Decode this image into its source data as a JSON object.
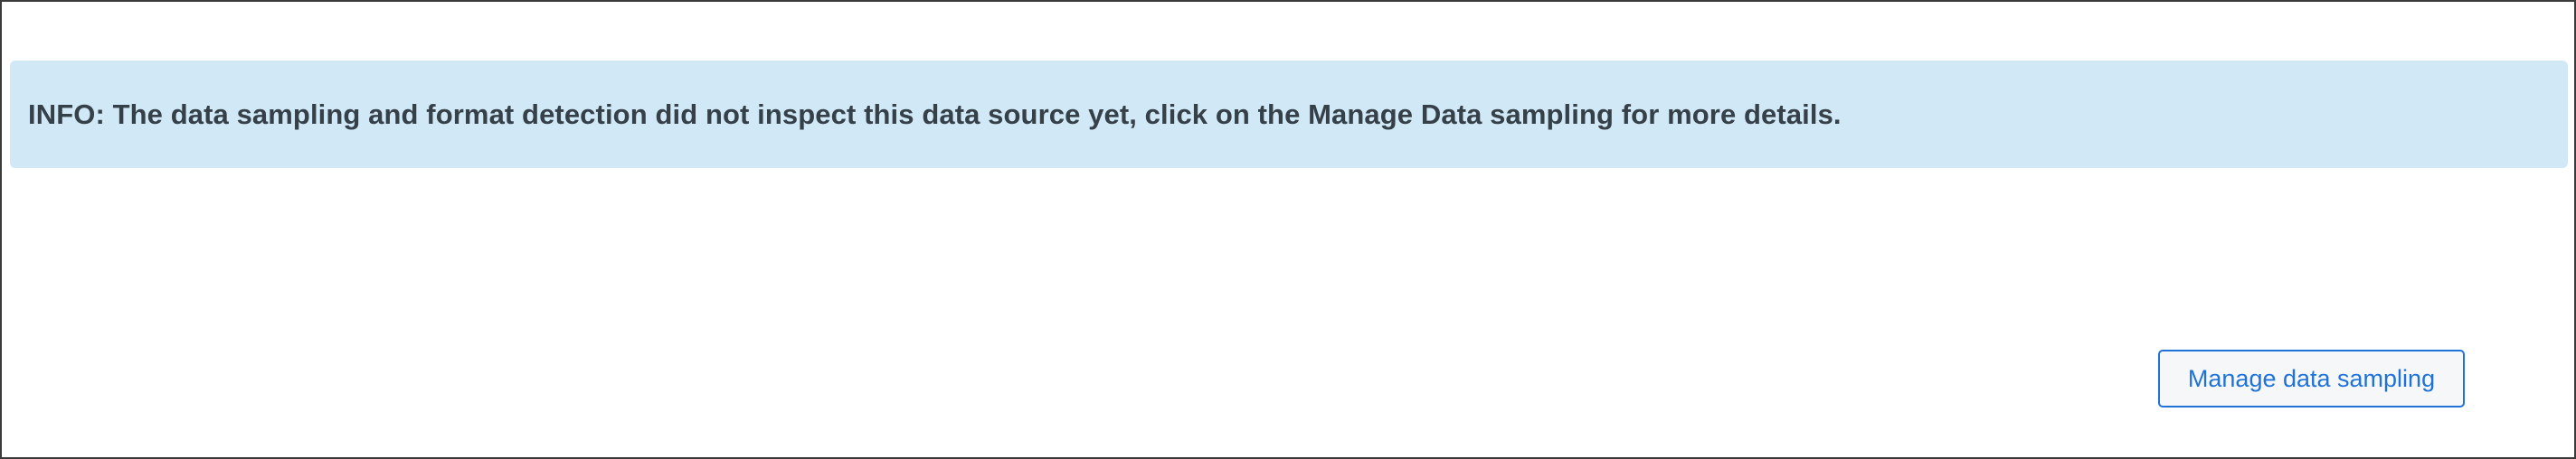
{
  "info_banner": {
    "text": "INFO: The data sampling and format detection did not inspect this data source yet, click on the Manage Data sampling for more details."
  },
  "actions": {
    "manage_button_label": "Manage data sampling"
  },
  "colors": {
    "banner_background": "#d1e9f7",
    "banner_text": "#354048",
    "button_accent": "#1f73d8",
    "button_background": "#f6f7f8",
    "frame_border": "#3b3b3b"
  }
}
